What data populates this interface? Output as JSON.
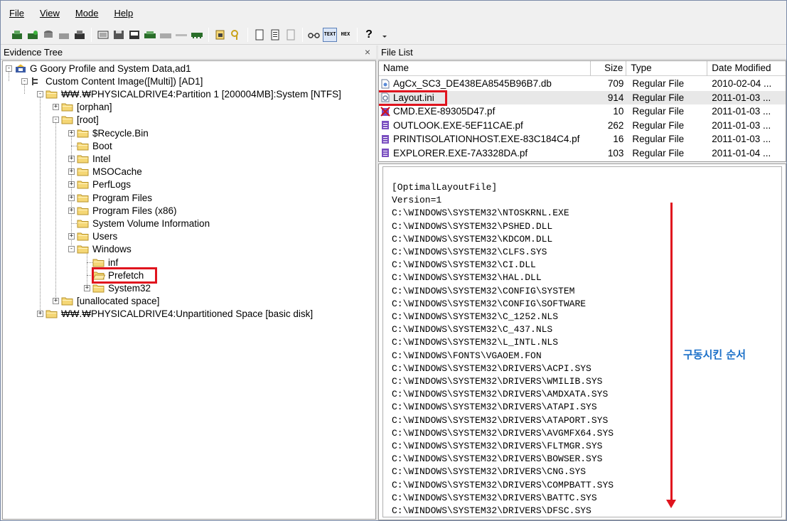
{
  "menu": [
    "File",
    "View",
    "Mode",
    "Help"
  ],
  "panes": {
    "evidence_title": "Evidence Tree",
    "close_glyph": "×",
    "filelist_title": "File List"
  },
  "tree": [
    {
      "label": "G Goory Profile and System Data,ad1",
      "exp": "-",
      "icon": "evidence-icon"
    },
    {
      "label": "Custom Content Image([Multi]) [AD1]",
      "exp": "-",
      "icon": "image-icon"
    },
    {
      "label": "₩₩.₩PHYSICALDRIVE4:Partition 1 [200004MB]:System [NTFS]",
      "exp": "-",
      "icon": "folder-icon"
    },
    {
      "label": "[orphan]",
      "exp": "+",
      "icon": "folder-icon"
    },
    {
      "label": "[root]",
      "exp": "-",
      "icon": "folder-icon"
    },
    {
      "label": "$Recycle.Bin",
      "exp": "+",
      "icon": "folder-icon"
    },
    {
      "label": "Boot",
      "exp": "",
      "icon": "folder-icon"
    },
    {
      "label": "Intel",
      "exp": "+",
      "icon": "folder-icon"
    },
    {
      "label": "MSOCache",
      "exp": "+",
      "icon": "folder-icon"
    },
    {
      "label": "PerfLogs",
      "exp": "+",
      "icon": "folder-icon"
    },
    {
      "label": "Program Files",
      "exp": "+",
      "icon": "folder-icon"
    },
    {
      "label": "Program Files (x86)",
      "exp": "+",
      "icon": "folder-icon"
    },
    {
      "label": "System Volume Information",
      "exp": "",
      "icon": "folder-icon"
    },
    {
      "label": "Users",
      "exp": "+",
      "icon": "folder-icon"
    },
    {
      "label": "Windows",
      "exp": "-",
      "icon": "folder-icon"
    },
    {
      "label": "inf",
      "exp": "",
      "icon": "folder-icon"
    },
    {
      "label": "Prefetch",
      "exp": "",
      "icon": "folder-open-icon"
    },
    {
      "label": "System32",
      "exp": "+",
      "icon": "folder-icon"
    },
    {
      "label": "[unallocated space]",
      "exp": "+",
      "icon": "folder-icon"
    },
    {
      "label": "₩₩.₩PHYSICALDRIVE4:Unpartitioned Space [basic disk]",
      "exp": "+",
      "icon": "folder-icon"
    }
  ],
  "filelist": {
    "columns": [
      "Name",
      "Size",
      "Type",
      "Date Modified"
    ],
    "rows": [
      {
        "name": "AgCx_SC3_DE438EA8545B96B7.db",
        "size": "709",
        "type": "Regular File",
        "date": "2010-02-04 ...",
        "icon": "db-file-icon"
      },
      {
        "name": "Layout.ini",
        "size": "914",
        "type": "Regular File",
        "date": "2011-01-03 ...",
        "icon": "ini-file-icon"
      },
      {
        "name": "CMD.EXE-89305D47.pf",
        "size": "10",
        "type": "Regular File",
        "date": "2011-01-03 ...",
        "icon": "deleted-file-icon"
      },
      {
        "name": "OUTLOOK.EXE-5EF11CAE.pf",
        "size": "262",
        "type": "Regular File",
        "date": "2011-01-03 ...",
        "icon": "pf-file-icon"
      },
      {
        "name": "PRINTISOLATIONHOST.EXE-83C184C4.pf",
        "size": "16",
        "type": "Regular File",
        "date": "2011-01-03 ...",
        "icon": "pf-file-icon"
      },
      {
        "name": "EXPLORER.EXE-7A3328DA.pf",
        "size": "103",
        "type": "Regular File",
        "date": "2011-01-04 ...",
        "icon": "pf-file-icon"
      }
    ]
  },
  "text_view": [
    "[OptimalLayoutFile]",
    "Version=1",
    "C:\\WINDOWS\\SYSTEM32\\NTOSKRNL.EXE",
    "C:\\WINDOWS\\SYSTEM32\\PSHED.DLL",
    "C:\\WINDOWS\\SYSTEM32\\KDCOM.DLL",
    "C:\\WINDOWS\\SYSTEM32\\CLFS.SYS",
    "C:\\WINDOWS\\SYSTEM32\\CI.DLL",
    "C:\\WINDOWS\\SYSTEM32\\HAL.DLL",
    "C:\\WINDOWS\\SYSTEM32\\CONFIG\\SYSTEM",
    "C:\\WINDOWS\\SYSTEM32\\CONFIG\\SOFTWARE",
    "C:\\WINDOWS\\SYSTEM32\\C_1252.NLS",
    "C:\\WINDOWS\\SYSTEM32\\C_437.NLS",
    "C:\\WINDOWS\\SYSTEM32\\L_INTL.NLS",
    "C:\\WINDOWS\\FONTS\\VGAOEM.FON",
    "C:\\WINDOWS\\SYSTEM32\\DRIVERS\\ACPI.SYS",
    "C:\\WINDOWS\\SYSTEM32\\DRIVERS\\WMILIB.SYS",
    "C:\\WINDOWS\\SYSTEM32\\DRIVERS\\AMDXATA.SYS",
    "C:\\WINDOWS\\SYSTEM32\\DRIVERS\\ATAPI.SYS",
    "C:\\WINDOWS\\SYSTEM32\\DRIVERS\\ATAPORT.SYS",
    "C:\\WINDOWS\\SYSTEM32\\DRIVERS\\AVGMFX64.SYS",
    "C:\\WINDOWS\\SYSTEM32\\DRIVERS\\FLTMGR.SYS",
    "C:\\WINDOWS\\SYSTEM32\\DRIVERS\\BOWSER.SYS",
    "C:\\WINDOWS\\SYSTEM32\\DRIVERS\\CNG.SYS",
    "C:\\WINDOWS\\SYSTEM32\\DRIVERS\\COMPBATT.SYS",
    "C:\\WINDOWS\\SYSTEM32\\DRIVERS\\BATTC.SYS",
    "C:\\WINDOWS\\SYSTEM32\\DRIVERS\\DFSC.SYS"
  ],
  "annotation": {
    "text": "구동시킨 순서",
    "color": "#1a6fc8",
    "arrow_color": "#e0141e"
  },
  "colors": {
    "highlight": "#e0141e",
    "folder": "#f5d776",
    "folder_edge": "#b8932a"
  },
  "toolbar": {
    "text_label": "TEXT",
    "hex_label": "HEX",
    "help_glyph": "?"
  }
}
